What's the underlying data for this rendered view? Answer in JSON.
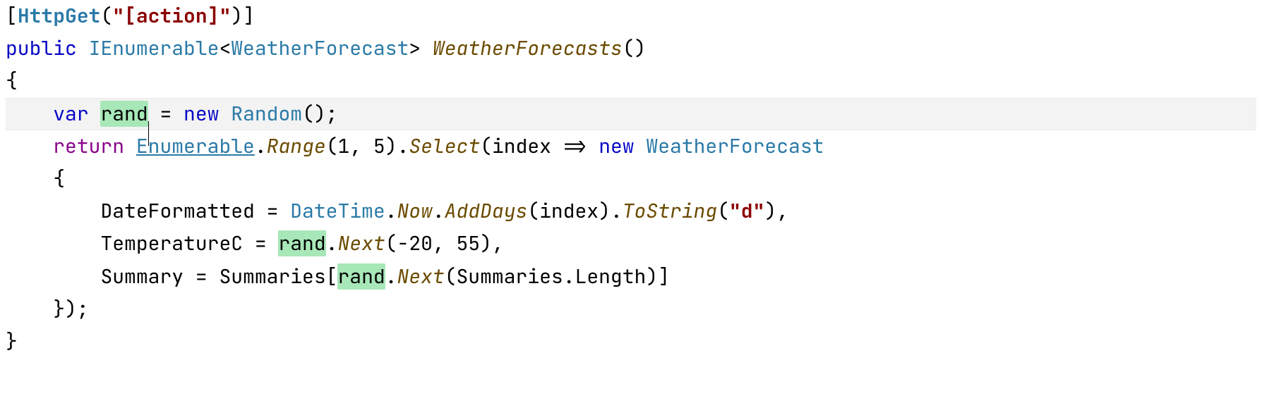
{
  "colors": {
    "highlight_bg": "#a7e7b8",
    "current_line_bg": "#f3f3f3"
  },
  "code": {
    "line1": {
      "open_bracket": "[",
      "attr_name": "HttpGet",
      "open_paren": "(",
      "str_open": "\"",
      "str_body": "[action]",
      "str_close": "\"",
      "close_paren": ")",
      "close_bracket": "]"
    },
    "line2": {
      "kw_public": "public",
      "type_ienumerable": "IEnumerable",
      "lt": "<",
      "type_forecast": "WeatherForecast",
      "gt": ">",
      "method_name": "WeatherForecasts",
      "parens": "()"
    },
    "line3": {
      "brace": "{"
    },
    "line4": {
      "kw_var": "var",
      "var_name": "rand",
      "eq": " = ",
      "kw_new": "new",
      "type_random": "Random",
      "parens_semi": "();"
    },
    "line5": {
      "kw_return": "return",
      "type_enumerable": "Enumerable",
      "dot1": ".",
      "m_range": "Range",
      "args_range_open": "(",
      "num1": "1",
      "comma1": ", ",
      "num5": "5",
      "args_range_close": ")",
      "dot2": ".",
      "m_select": "Select",
      "lambda_open": "(",
      "lambda_param": "index",
      "lambda_arrow": " => ",
      "kw_new": "new",
      "type_forecast": "WeatherForecast"
    },
    "line6": {
      "brace": "{"
    },
    "line7": {
      "prop": "DateFormatted",
      "eq": " = ",
      "type_datetime": "DateTime",
      "dot1": ".",
      "prop_now": "Now",
      "dot2": ".",
      "m_adddays": "AddDays",
      "args_ad_open": "(",
      "arg_index": "index",
      "args_ad_close": ")",
      "dot3": ".",
      "m_tostring": "ToString",
      "args_ts_open": "(",
      "str_open": "\"",
      "str_body": "d",
      "str_close": "\"",
      "args_ts_close": ")",
      "comma": ","
    },
    "line8": {
      "prop": "TemperatureC",
      "eq": " = ",
      "var_rand": "rand",
      "dot": ".",
      "m_next": "Next",
      "open": "(",
      "neg20": "-20",
      "comma": ", ",
      "n55": "55",
      "close": ")",
      "trailing": ","
    },
    "line9": {
      "prop": "Summary",
      "eq": " = ",
      "arr": "Summaries",
      "open_idx": "[",
      "var_rand": "rand",
      "dot": ".",
      "m_next": "Next",
      "open": "(",
      "arr2": "Summaries",
      "dot2": ".",
      "prop_len": "Length",
      "close": ")",
      "close_idx": "]"
    },
    "line10": {
      "brace_close": "});"
    },
    "line11": {
      "brace": "}"
    }
  }
}
